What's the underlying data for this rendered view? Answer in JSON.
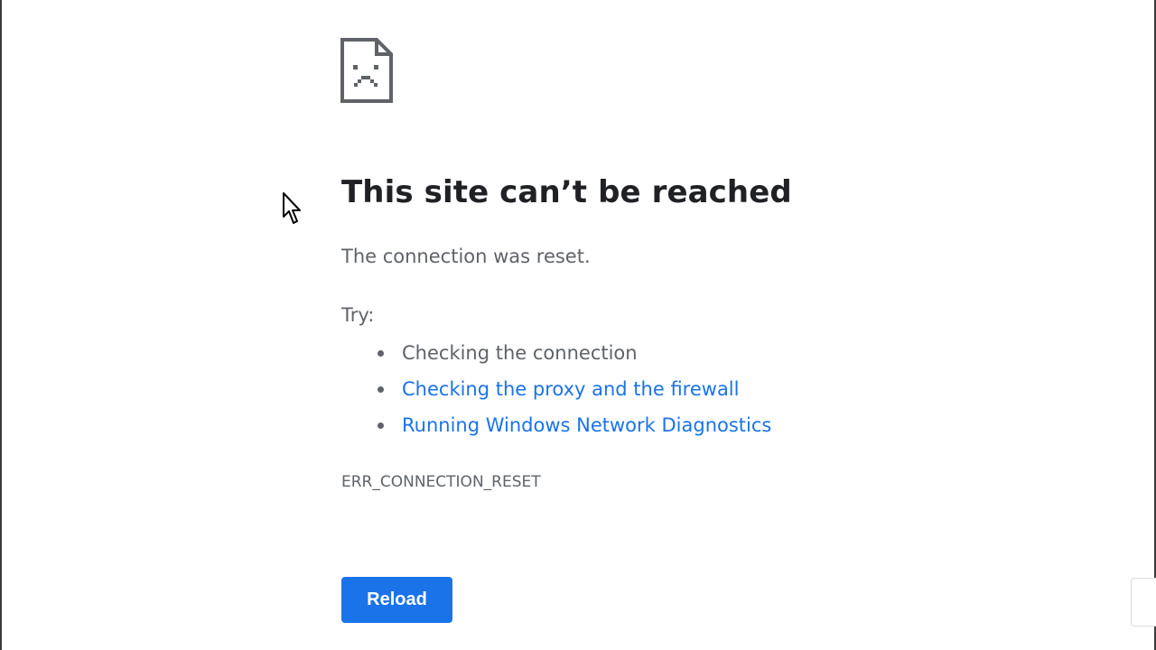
{
  "page": {
    "title": "This site can’t be reached",
    "subtitle": "The connection was reset.",
    "try_label": "Try:",
    "suggestions": [
      {
        "label": "Checking the connection",
        "link": false
      },
      {
        "label": "Checking the proxy and the firewall",
        "link": true
      },
      {
        "label": "Running Windows Network Diagnostics",
        "link": true
      }
    ],
    "error_code": "ERR_CONNECTION_RESET",
    "reload_label": "Reload"
  },
  "icons": {
    "error": "sad-page-icon",
    "pointer": "mouse-cursor-icon"
  },
  "colors": {
    "title": "#202124",
    "body_text": "#5f6368",
    "link": "#1a73e8",
    "button_bg": "#1a73e8",
    "button_text": "#ffffff"
  }
}
